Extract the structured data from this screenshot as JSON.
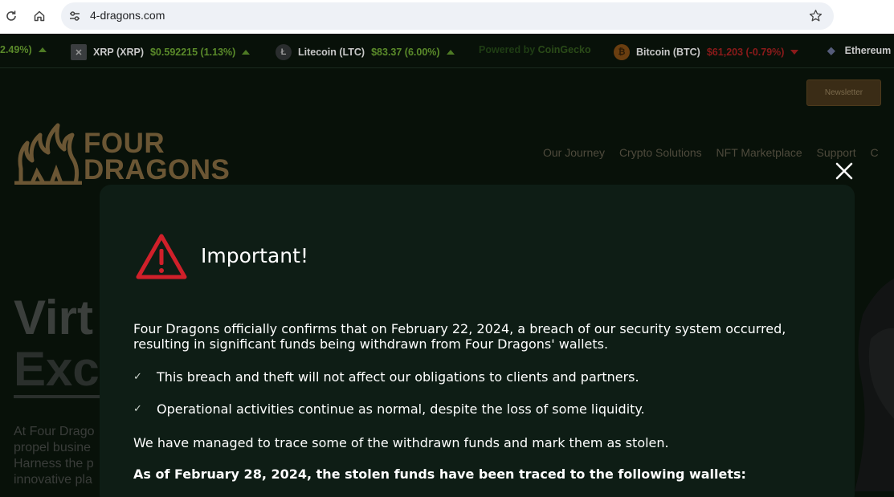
{
  "browser": {
    "url": "4-dragons.com",
    "icons": [
      "reload-icon",
      "home-icon",
      "site-settings-icon",
      "bookmark-star-icon"
    ]
  },
  "ticker": {
    "items": [
      {
        "name": "",
        "price": "2.49%)",
        "direction": "up"
      },
      {
        "name": "XRP (XRP)",
        "price": "$0.592215 (1.13%)",
        "direction": "up"
      },
      {
        "name": "Litecoin (LTC)",
        "price": "$83.37 (6.00%)",
        "direction": "up"
      },
      {
        "name": "Bitcoin (BTC)",
        "price": "$61,203 (-0.79%)",
        "direction": "down"
      },
      {
        "name": "Ethereum",
        "price": "",
        "direction": "none"
      }
    ],
    "powered_prefix": "Powered by",
    "powered_brand": "CoinGecko"
  },
  "header": {
    "newsletter_label": "Newsletter",
    "logo_line1": "FOUR",
    "logo_line2": "DRAGONS",
    "menu": [
      "Our Journey",
      "Crypto Solutions",
      "NFT Marketplace",
      "Support",
      "C"
    ]
  },
  "hero": {
    "title_line1": "Virt",
    "title_line2": "Exc",
    "para_lines": [
      "At Four Drago",
      "propel busine",
      "Harness the p",
      "innovative pla"
    ]
  },
  "modal": {
    "title": "Important!",
    "intro": "Four Dragons officially confirms that on February 22, 2024, a breach of our security system occurred, resulting in significant funds being withdrawn from Four Dragons' wallets.",
    "checks": [
      "This breach and theft will not affect our obligations to clients and partners.",
      "Operational activities continue as normal, despite the loss of some liquidity."
    ],
    "trace_text": "We have managed to trace some of the withdrawn funds and mark them as stolen.",
    "bold_text": "As of February 28, 2024, the stolen funds have been traced to the following wallets:"
  },
  "colors": {
    "site_bg": "#081109",
    "modal_bg": "#0e1d15",
    "warning_red": "#d0202a",
    "gold": "#6b5634",
    "ticker_up": "#5a8a2a",
    "ticker_down": "#8a1a1a"
  }
}
